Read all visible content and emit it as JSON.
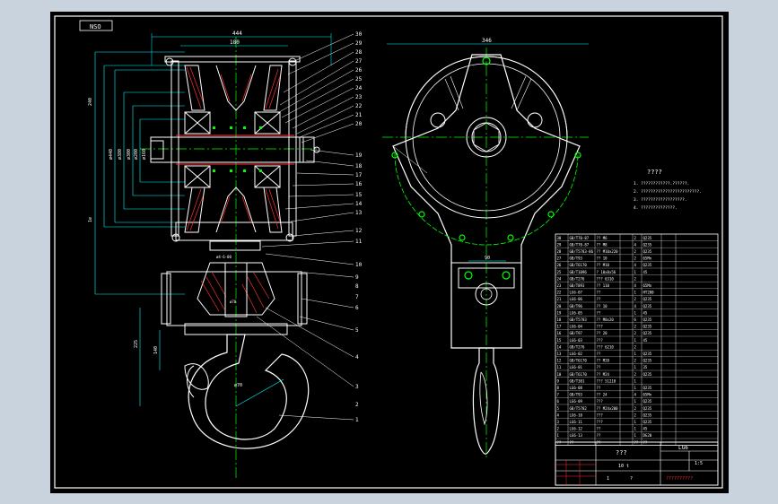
{
  "title_box_label": "NSO",
  "dimensions": {
    "top_overall": "444",
    "top_inner": "180",
    "right_width": "346",
    "left_height": "240",
    "left_total": "1e",
    "stack": [
      "ø440",
      "ø380",
      "ø300",
      "ø200",
      "ø160"
    ],
    "hook_a": "225",
    "hook_b": "140",
    "hook_r": "ø70",
    "bolt_gap": "90"
  },
  "part_numbers_upper": [
    "30",
    "29",
    "28",
    "27",
    "26",
    "25",
    "24",
    "23",
    "22",
    "21",
    "20",
    "19",
    "18",
    "17",
    "16",
    "15",
    "14",
    "13",
    "12",
    "11",
    "10"
  ],
  "part_numbers_lower": [
    "9",
    "8",
    "7",
    "6",
    "5",
    "4",
    "3",
    "2",
    "1"
  ],
  "notes": {
    "title": "????",
    "lines": [
      "1. ????????????.??????.",
      "2. ????????????????????????.",
      "3. ??????????????????.",
      "4. ??????????????."
    ]
  },
  "bom": {
    "rows": [
      [
        "30",
        "GB/T70-87",
        "?? M6",
        "",
        "2",
        "Q235",
        "",
        ""
      ],
      [
        "29",
        "GB/T70-87",
        "?? M8",
        "",
        "4",
        "Q235",
        "",
        ""
      ],
      [
        "28",
        "GB/T5783-86",
        "?? M10x220",
        "",
        "2",
        "Q235",
        "",
        ""
      ],
      [
        "27",
        "GB/T93",
        "?? 10",
        "",
        "2",
        "65Mn",
        "",
        ""
      ],
      [
        "26",
        "GB/T6170",
        "?? M10",
        "",
        "4",
        "Q235",
        "",
        ""
      ],
      [
        "25",
        "GB/T1096",
        "? 10x8x56",
        "",
        "1",
        "45",
        "",
        ""
      ],
      [
        "24",
        "GB/T276",
        "??? 6310",
        "",
        "2",
        "",
        "",
        ""
      ],
      [
        "23",
        "GB/T893",
        "?? 110",
        "",
        "4",
        "65Mn",
        "",
        ""
      ],
      [
        "22",
        "LG6-07",
        "??",
        "",
        "1",
        "HT200",
        "",
        ""
      ],
      [
        "21",
        "LG6-06",
        "??",
        "",
        "2",
        "Q235",
        "",
        ""
      ],
      [
        "20",
        "GB/T96",
        "?? 10",
        "",
        "4",
        "Q235",
        "",
        ""
      ],
      [
        "19",
        "LG6-05",
        "??",
        "",
        "1",
        "45",
        "",
        ""
      ],
      [
        "18",
        "GB/T5783",
        "?? M8x20",
        "",
        "6",
        "Q235",
        "",
        ""
      ],
      [
        "17",
        "LG6-04",
        "???",
        "",
        "2",
        "Q235",
        "",
        ""
      ],
      [
        "16",
        "GB/T97",
        "?? 20",
        "",
        "2",
        "Q235",
        "",
        ""
      ],
      [
        "15",
        "LG6-03",
        "???",
        "",
        "1",
        "45",
        "",
        ""
      ],
      [
        "14",
        "GB/T276",
        "??? 6210",
        "",
        "2",
        "",
        "",
        ""
      ],
      [
        "13",
        "LG6-02",
        "??",
        "",
        "1",
        "Q235",
        "",
        ""
      ],
      [
        "12",
        "GB/T6170",
        "?? M20",
        "",
        "2",
        "Q235",
        "",
        ""
      ],
      [
        "11",
        "LG6-01",
        "??",
        "",
        "1",
        "35",
        "",
        ""
      ],
      [
        "10",
        "GB/T6170",
        "?? M24",
        "",
        "2",
        "Q235",
        "",
        ""
      ],
      [
        "9",
        "GB/T301",
        "??? 51210",
        "",
        "1",
        "",
        "",
        ""
      ],
      [
        "8",
        "LG6-08",
        "??",
        "",
        "1",
        "Q235",
        "",
        ""
      ],
      [
        "7",
        "GB/T93",
        "?? 24",
        "",
        "4",
        "65Mn",
        "",
        ""
      ],
      [
        "6",
        "LG6-09",
        "???",
        "",
        "1",
        "Q235",
        "",
        ""
      ],
      [
        "5",
        "GB/T5782",
        "?? M24x200",
        "",
        "2",
        "Q235",
        "",
        ""
      ],
      [
        "4",
        "LG6-10",
        "???",
        "",
        "2",
        "Q235",
        "",
        ""
      ],
      [
        "3",
        "LG6-11",
        "???",
        "",
        "1",
        "Q235",
        "",
        ""
      ],
      [
        "2",
        "LG6-12",
        "??",
        "",
        "1",
        "45",
        "",
        ""
      ],
      [
        "1",
        "LG6-13",
        "??",
        "",
        "1",
        "DG20",
        "",
        ""
      ],
      [
        "??",
        "??",
        "??",
        "",
        "??",
        "??",
        "",
        ""
      ]
    ],
    "title_block": {
      "drawing_no": "LG6",
      "name": "???",
      "load": "10 t",
      "scale": "1:5",
      "sheet": "1",
      "page": "?",
      "company": "??????????"
    }
  }
}
